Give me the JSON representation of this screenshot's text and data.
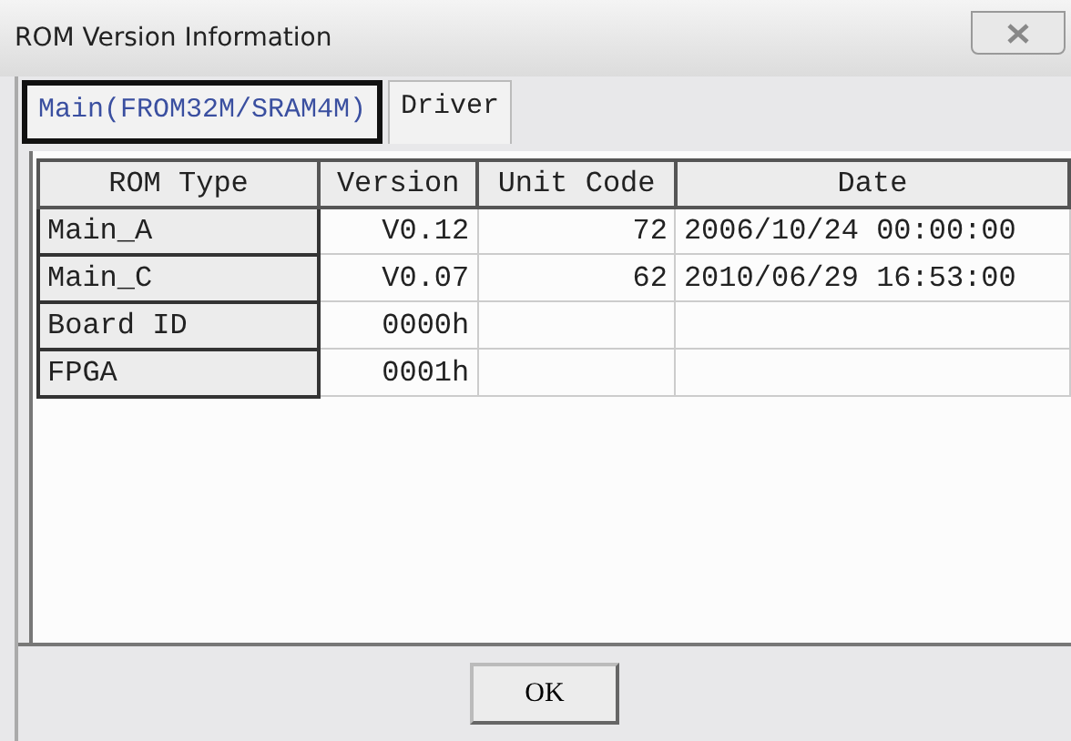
{
  "window": {
    "title": "ROM Version Information"
  },
  "tabs": [
    {
      "label": "Main(FROM32M/SRAM4M)",
      "selected": true
    },
    {
      "label": "Driver",
      "selected": false
    }
  ],
  "table": {
    "columns": [
      "ROM Type",
      "Version",
      "Unit Code",
      "Date"
    ],
    "rows": [
      {
        "rom_type": "Main_A",
        "version": "V0.12",
        "unit_code": "72",
        "date": "2006/10/24 00:00:00"
      },
      {
        "rom_type": "Main_C",
        "version": "V0.07",
        "unit_code": "62",
        "date": "2010/06/29 16:53:00"
      },
      {
        "rom_type": "Board ID",
        "version": "0000h"
      },
      {
        "rom_type": "FPGA",
        "version": "0001h"
      }
    ]
  },
  "buttons": [
    "OK"
  ]
}
